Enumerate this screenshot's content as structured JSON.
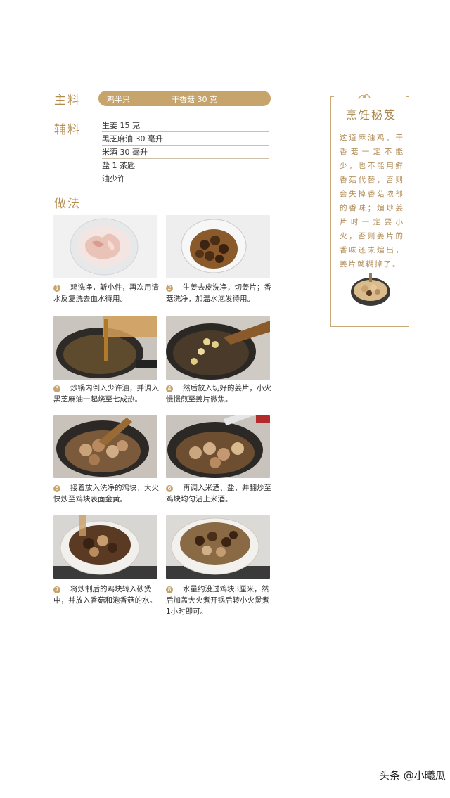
{
  "sections": {
    "main_label": "主料",
    "aux_label": "辅料",
    "method_label": "做法"
  },
  "main_ingredients": [
    "鸡半只",
    "干香菇 30 克"
  ],
  "aux_ingredients": [
    "生姜 15 克",
    "黑芝麻油 30 毫升",
    "米酒 30 毫升",
    "盐 1 茶匙",
    "油少许"
  ],
  "steps": [
    {
      "num": "1",
      "text": "鸡洗净，斩小件，再次用清水反复洗去血水待用。"
    },
    {
      "num": "2",
      "text": "生姜去皮洗净，切姜片；香菇洗净，加温水泡发待用。"
    },
    {
      "num": "3",
      "text": "炒锅内倒入少许油，并调入黑芝麻油一起烧至七成热。"
    },
    {
      "num": "4",
      "text": "然后放入切好的姜片，小火慢慢煎至姜片微焦。"
    },
    {
      "num": "5",
      "text": "接着放入洗净的鸡块，大火快炒至鸡块表面金黄。"
    },
    {
      "num": "6",
      "text": "再调入米酒、盐，并翻炒至鸡块均匀沾上米酒。"
    },
    {
      "num": "7",
      "text": "将炒制后的鸡块转入砂煲中，并放入香菇和泡香菇的水。"
    },
    {
      "num": "8",
      "text": "水量约没过鸡块3厘米，然后加盖大火煮开锅后转小火煲煮1小时即可。"
    }
  ],
  "tip": {
    "title": "烹饪秘笈",
    "text": "这道麻油鸡，干香菇一定不能少，也不能用鲜香菇代替，否则会失掉香菇浓郁的香味；煸炒姜片时一定要小火，否则姜片的香味还未煸出，姜片就糊掉了。"
  },
  "watermark": "头条 @小曦瓜",
  "colors": {
    "accent": "#c6a46c",
    "title_gold": "#b58a4e",
    "tip_text": "#b08b55"
  }
}
